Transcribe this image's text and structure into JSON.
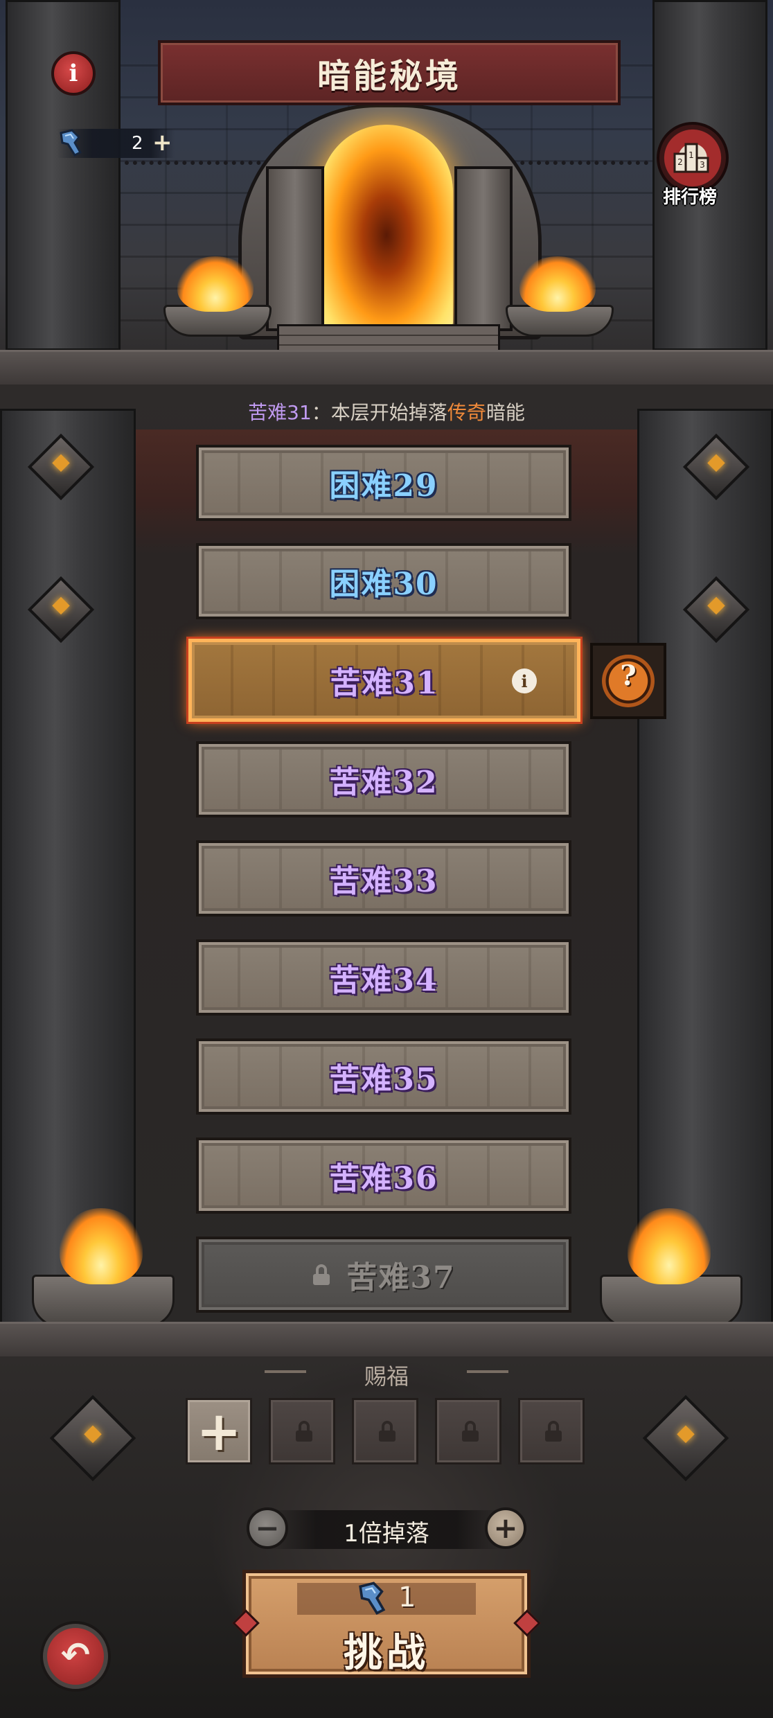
{
  "header": {
    "title": "暗能秘境",
    "info_icon": "info-icon",
    "currency": {
      "icon": "dark-key-icon",
      "amount": "2",
      "add": "+"
    },
    "rank_button": {
      "icon": "podium-icon",
      "label": "排行榜"
    }
  },
  "notice": {
    "prefix": "苦难31",
    "middle": "：本层开始掉落",
    "highlight": "传奇",
    "suffix": "暗能"
  },
  "levels": [
    {
      "label": "困难29",
      "tier": "hard",
      "state": "normal"
    },
    {
      "label": "困难30",
      "tier": "hard",
      "state": "normal"
    },
    {
      "label": "苦难31",
      "tier": "pain",
      "state": "selected"
    },
    {
      "label": "苦难32",
      "tier": "pain",
      "state": "normal"
    },
    {
      "label": "苦难33",
      "tier": "pain",
      "state": "normal"
    },
    {
      "label": "苦难34",
      "tier": "pain",
      "state": "normal"
    },
    {
      "label": "苦难35",
      "tier": "pain",
      "state": "normal"
    },
    {
      "label": "苦难36",
      "tier": "pain",
      "state": "normal"
    },
    {
      "label": "苦难37",
      "tier": "pain",
      "state": "locked"
    }
  ],
  "help_button": {
    "icon": "question-icon",
    "glyph": "?"
  },
  "blessing": {
    "title": "赐福",
    "slots": [
      {
        "state": "add",
        "glyph": "+"
      },
      {
        "state": "locked"
      },
      {
        "state": "locked"
      },
      {
        "state": "locked"
      },
      {
        "state": "locked"
      }
    ]
  },
  "multiplier": {
    "label": "1倍掉落",
    "minus": "−",
    "plus": "+"
  },
  "challenge": {
    "cost": "1",
    "cost_icon": "dark-key-icon",
    "label": "挑战"
  },
  "back_button": {
    "icon": "back-arrow-icon",
    "glyph": "↶"
  },
  "colors": {
    "hard_text": "#8ad0ff",
    "pain_text": "#d4b2ff",
    "legend": "#f08a3a",
    "selected_border": "#ffb45a"
  }
}
